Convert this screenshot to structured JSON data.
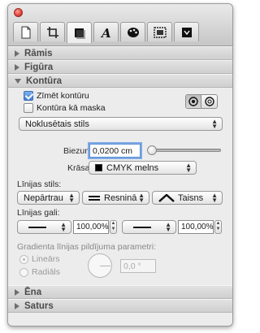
{
  "window": {
    "tabs": [
      {
        "icon": "document-icon",
        "active": false
      },
      {
        "icon": "crop-icon",
        "active": false
      },
      {
        "icon": "graphic-icon",
        "active": true
      },
      {
        "icon": "text-icon",
        "active": false
      },
      {
        "icon": "palette-icon",
        "active": false
      },
      {
        "icon": "media-icon",
        "active": false
      },
      {
        "icon": "lock-icon",
        "active": false
      }
    ]
  },
  "sections": {
    "ramis": "Rāmis",
    "figura": "Figūra",
    "kontura": "Kontūra",
    "ena": "Ēna",
    "saturs": "Saturs"
  },
  "contour": {
    "draw_contour_label": "Zīmēt kontūru",
    "draw_contour_checked": true,
    "mask_label": "Kontūra kā maska",
    "mask_checked": false,
    "style_popup": "Noklusētais stils",
    "width_label": "Biezums:",
    "width_value": "0,0200 cm",
    "width_slider_fraction": 0.05,
    "color_label": "Krāsa:",
    "color_value": "CMYK melns",
    "color_swatch": "#000000"
  },
  "line_style": {
    "label": "Līnijas stils:",
    "dash_popup": "Nepārtrau",
    "join_popup": "Resninā",
    "cap_popup": "Taisns"
  },
  "line_ends": {
    "label": "Līnijas gali:",
    "start_scale": "100,00%",
    "end_scale": "100,00%"
  },
  "gradient": {
    "label": "Gradienta līnijas pildījuma parametri:",
    "linear_label": "Lineārs",
    "linear_selected": true,
    "radial_label": "Radiāls",
    "angle_value": "0,0 °"
  }
}
